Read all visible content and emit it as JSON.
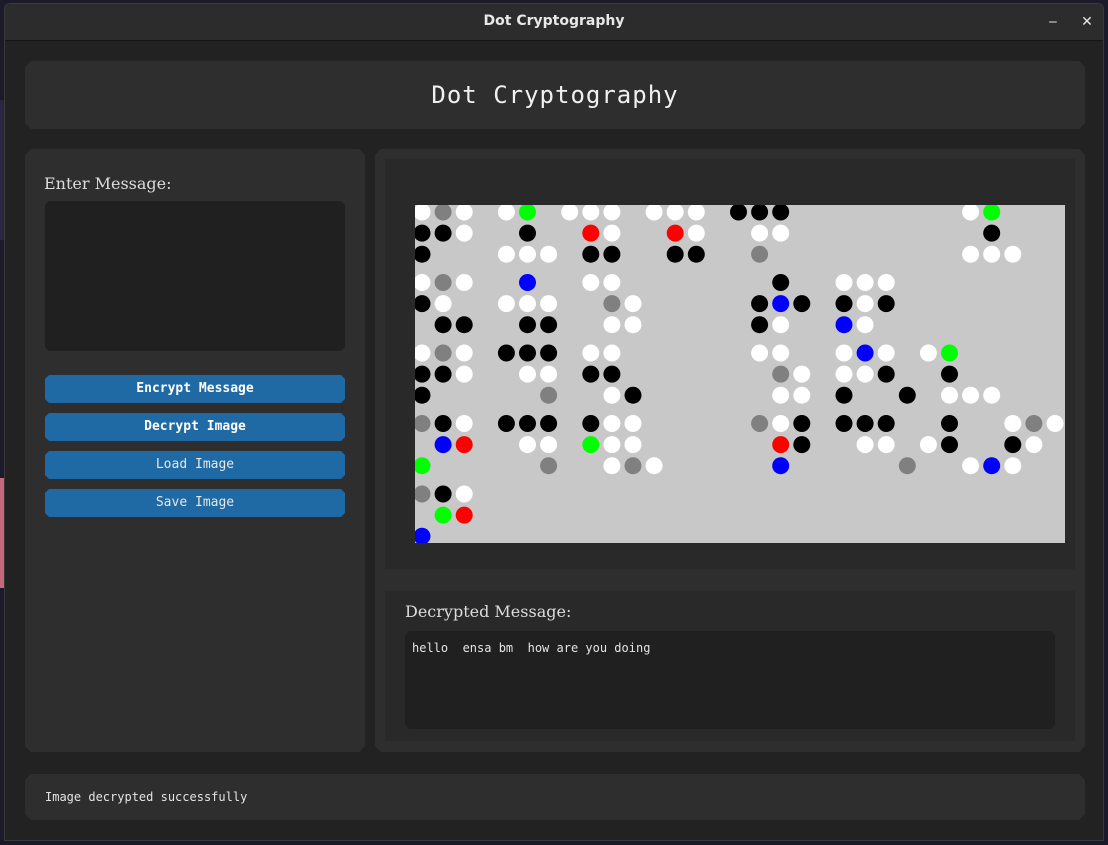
{
  "window": {
    "title": "Dot Cryptography",
    "minimize_glyph": "‒",
    "close_glyph": "✕"
  },
  "header": {
    "title": "Dot Cryptography"
  },
  "left_panel": {
    "message_label": "Enter Message:",
    "message_value": "",
    "buttons": {
      "encrypt": "Encrypt Message",
      "decrypt": "Decrypt Image",
      "load": "Load Image",
      "save": "Save Image"
    }
  },
  "decrypted": {
    "label": "Decrypted Message:",
    "value": "hello  ensa bm  how are you doing"
  },
  "status": {
    "text": "Image decrypted successfully"
  },
  "colors": {
    "accent": "#1f6aa5",
    "canvas_bg": "#c8c8c8",
    "dot_palette": {
      "W": "#ffffff",
      "K": "#000000",
      "G": "#808080",
      "R": "#ff0000",
      "B": "#0000ff",
      "N": "#00ff00"
    }
  },
  "dot_image": {
    "description_icon": "dot-pattern-image",
    "rows": [
      "WGW.WN.WWW.WWW.KKK........WN",
      "KKW..K..RW..RW..WW.........K",
      "K...WWW.KK..KK..G.........WWW",
      "WGW..B..WW.......K..WWW",
      "KW..WWW..GW.....KBK.KWK",
      ".KK..KK..WW.....KW..BW",
      "WGW.KKK.WW......WW..WBW.WN",
      "KKW..WW.KK.......GW.WWK..K",
      "K.....G..WK......WW.K..K.WWW",
      "GKW.KKK.KWW.....GWK.KKK..K..WGW",
      ".BR..WW.NWW......RK..WW.WK..KW",
      "N.....G..WGW.....B.....G..WBW..KK",
      "GKW",
      ".NR",
      "B"
    ]
  }
}
